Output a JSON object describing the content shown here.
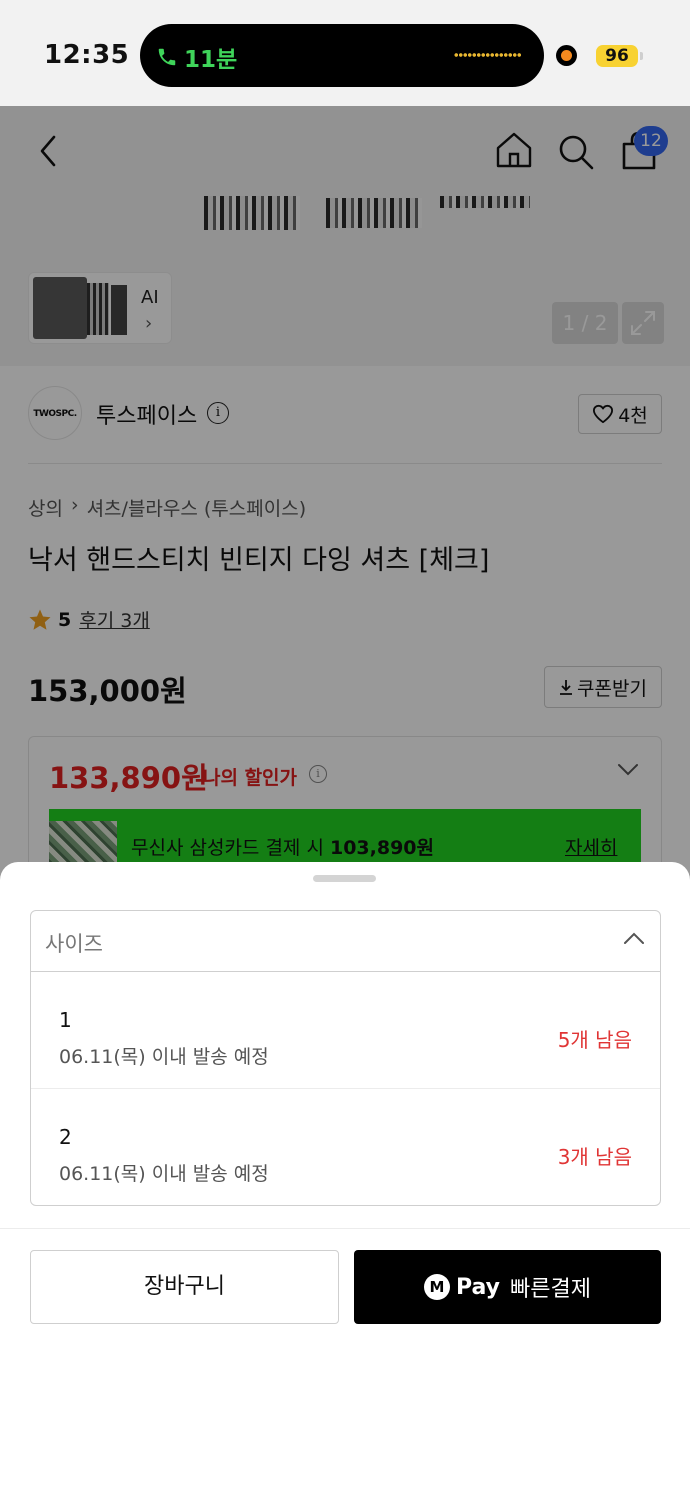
{
  "status_bar": {
    "time": "12:35",
    "call_duration": "11분",
    "battery": "96"
  },
  "header": {
    "cart_count": "12"
  },
  "gallery": {
    "ai_label": "AI",
    "ai_chevron": "›",
    "page_indicator": "1 / 2"
  },
  "brand": {
    "logo_text": "TWOSPC.",
    "name": "투스페이스",
    "info_glyph": "i",
    "likes": "4천"
  },
  "breadcrumb": {
    "category": "상의",
    "separator": "›",
    "subcategory": "셔츠/블라우스 (투스페이스)"
  },
  "product": {
    "title": "낙서 핸드스티치 빈티지 다잉 셔츠 [체크]",
    "rating": "5",
    "reviews": "후기 3개",
    "price": "153,000원",
    "coupon_label": "쿠폰받기"
  },
  "discount": {
    "price": "133,890원",
    "label": "나의 할인가",
    "info_glyph": "i",
    "card_text": "무신사 삼성카드 결제 시",
    "card_price": "103,890원",
    "card_link": "자세히"
  },
  "option_sheet": {
    "title": "사이즈",
    "options": [
      {
        "name": "1",
        "shipping": "06.11(목) 이내 발송 예정",
        "stock": "5개 남음"
      },
      {
        "name": "2",
        "shipping": "06.11(목) 이내 발송 예정",
        "stock": "3개 남음"
      }
    ]
  },
  "actions": {
    "cart_label": "장바구니",
    "pay_badge": "M",
    "pay_word": "Pay",
    "pay_label": "빠른결제"
  },
  "icons": {
    "phone": "phone-icon",
    "back": "chevron-left-icon",
    "home": "home-icon",
    "search": "search-icon",
    "bag": "shopping-bag-icon",
    "expand": "expand-icon",
    "heart": "heart-icon",
    "star": "star-icon",
    "download": "download-icon",
    "chevron_down": "chevron-down-icon",
    "chevron_up": "chevron-up-icon"
  },
  "colors": {
    "accent_red": "#e02020",
    "stock_red": "#e03535",
    "call_green": "#3fd45a",
    "card_green": "#22d322",
    "badge_blue": "#3366ee",
    "battery_yellow": "#f8d232",
    "pay_black": "#000000"
  }
}
